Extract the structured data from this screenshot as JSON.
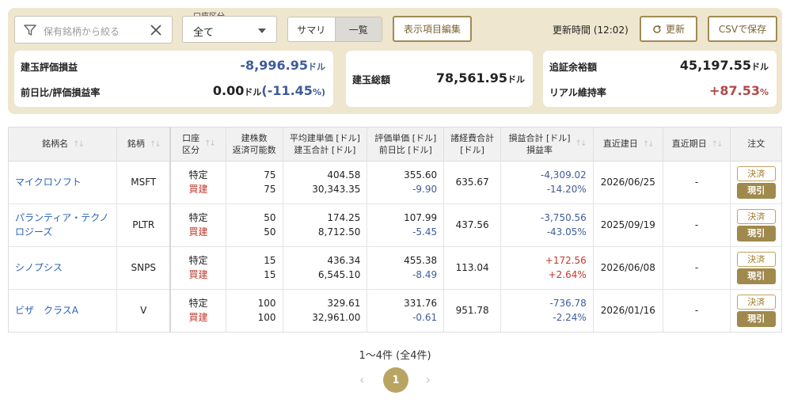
{
  "filter": {
    "placeholder": "保有銘柄から絞る"
  },
  "account": {
    "label": "口座区分",
    "value": "全て"
  },
  "view_toggle": {
    "summary": "サマリ",
    "list": "一覧"
  },
  "toolbar": {
    "edit_columns": "表示項目編集",
    "update_time": "更新時間 (12:02)",
    "refresh": "更新",
    "csv": "CSVで保存"
  },
  "summary": {
    "pl_label": "建玉評価損益",
    "pl_value": "-8,996.95",
    "unit": "ドル",
    "daychange_label": "前日比/評価損益率",
    "daychange_value": "0.00",
    "daychange_unit": "ドル",
    "daychange_rate": "(-11.45",
    "pct": "%)",
    "total_label": "建玉総額",
    "total_value": "78,561.95",
    "margin_label": "追証余裕額",
    "margin_value": "45,197.55",
    "ratio_label": "リアル維持率",
    "ratio_value": "+87.53",
    "ratio_unit": "%"
  },
  "table": {
    "headers": {
      "name": "銘柄名",
      "ticker": "銘柄",
      "account_1": "口座",
      "account_2": "区分",
      "qty_1": "建株数",
      "qty_2": "返済可能数",
      "avg_1": "平均建単価 [ドル]",
      "avg_2": "建玉合計 [ドル]",
      "eval_1": "評価単価 [ドル]",
      "eval_2": "前日比 [ドル]",
      "fee_1": "諸経費合計",
      "fee_2": "[ドル]",
      "pl_1": "損益合計 [ドル]",
      "pl_2": "損益率",
      "open_date": "直近建日",
      "expiry": "直近期日",
      "order": "注文"
    },
    "rows": [
      {
        "name": "マイクロソフト",
        "ticker": "MSFT",
        "account": "特定",
        "type": "買建",
        "qty": "75",
        "avail": "75",
        "avg": "404.58",
        "total": "30,343.35",
        "eval": "355.60",
        "change": "-9.90",
        "fee": "635.67",
        "pl": "-4,309.02",
        "plrate": "-14.20%",
        "open_date": "2026/06/25",
        "expiry": "-",
        "btn1": "決済",
        "btn2": "現引"
      },
      {
        "name": "パランティア・テクノロジーズ",
        "ticker": "PLTR",
        "account": "特定",
        "type": "買建",
        "qty": "50",
        "avail": "50",
        "avg": "174.25",
        "total": "8,712.50",
        "eval": "107.99",
        "change": "-5.45",
        "fee": "437.56",
        "pl": "-3,750.56",
        "plrate": "-43.05%",
        "open_date": "2025/09/19",
        "expiry": "-",
        "btn1": "決済",
        "btn2": "現引"
      },
      {
        "name": "シノプシス",
        "ticker": "SNPS",
        "account": "特定",
        "type": "買建",
        "qty": "15",
        "avail": "15",
        "avg": "436.34",
        "total": "6,545.10",
        "eval": "455.38",
        "change": "-8.49",
        "fee": "113.04",
        "pl": "+172.56",
        "plrate": "+2.64%",
        "open_date": "2026/06/08",
        "expiry": "-",
        "btn1": "決済",
        "btn2": "現引"
      },
      {
        "name": "ビザ　クラスA",
        "ticker": "V",
        "account": "特定",
        "type": "買建",
        "qty": "100",
        "avail": "100",
        "avg": "329.61",
        "total": "32,961.00",
        "eval": "331.76",
        "change": "-0.61",
        "fee": "951.78",
        "pl": "-736.78",
        "plrate": "-2.24%",
        "open_date": "2026/01/16",
        "expiry": "-",
        "btn1": "決済",
        "btn2": "現引"
      }
    ]
  },
  "pager": {
    "count": "1〜4件 (全4件)",
    "current": "1",
    "prev": "‹",
    "next": "›"
  },
  "colors": {
    "panel": "#efe6cf",
    "gold": "#a28a52",
    "negative": "#3e5c9a",
    "positive": "#b24a4a"
  }
}
